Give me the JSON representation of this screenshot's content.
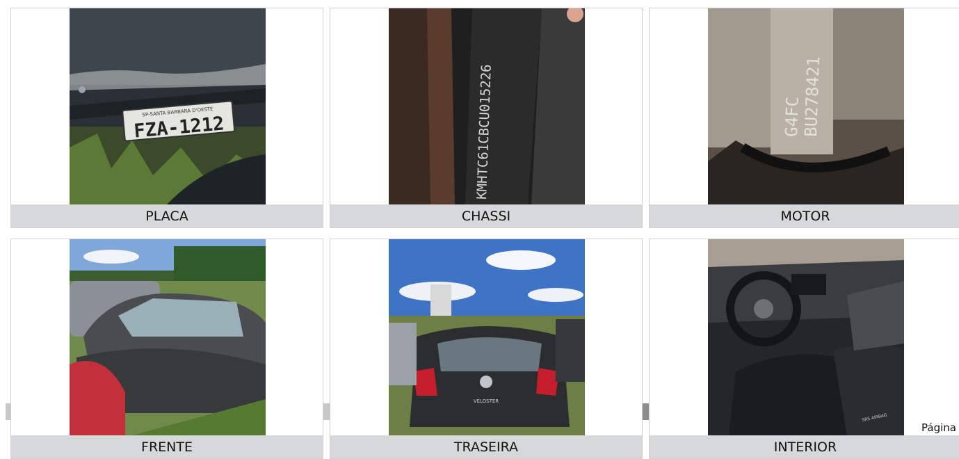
{
  "photos": [
    {
      "caption": "PLACA",
      "plate_region": "SP-SANTA BARBARA D'OESTE",
      "plate_number": "FZA-1212"
    },
    {
      "caption": "CHASSI",
      "vin": "KMHTC61CBCU015226"
    },
    {
      "caption": "MOTOR",
      "engine_line1": "G4FC",
      "engine_line2": "BU278421"
    },
    {
      "caption": "FRENTE"
    },
    {
      "caption": "TRASEIRA",
      "badge": "VELOSTER"
    },
    {
      "caption": "INTERIOR",
      "airbag_label": "SRS AIRBAG"
    }
  ],
  "footer": {
    "page_label": "Página"
  }
}
